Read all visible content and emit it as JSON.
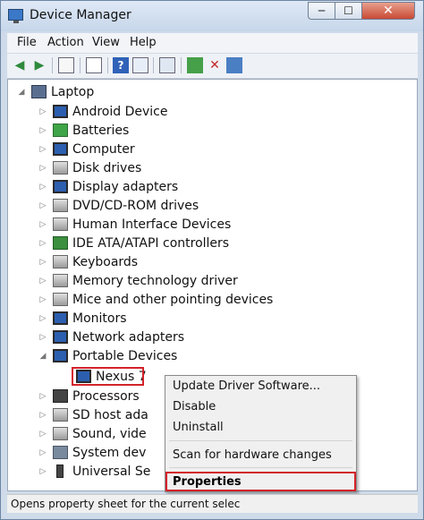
{
  "window": {
    "title": "Device Manager"
  },
  "menu": {
    "file": "File",
    "action": "Action",
    "view": "View",
    "help": "Help"
  },
  "toolbar": {
    "icons": [
      "back-icon",
      "forward-icon",
      "show-hide-icon",
      "properties-icon",
      "help-icon",
      "update-icon",
      "scan-icon",
      "update-driver-icon",
      "uninstall-icon",
      "enable-icon"
    ]
  },
  "tree": {
    "root": "Laptop",
    "items": [
      "Android Device",
      "Batteries",
      "Computer",
      "Disk drives",
      "Display adapters",
      "DVD/CD-ROM drives",
      "Human Interface Devices",
      "IDE ATA/ATAPI controllers",
      "Keyboards",
      "Memory technology driver",
      "Mice and other pointing devices",
      "Monitors",
      "Network adapters",
      "Portable Devices",
      "Nexus 7",
      "Processors",
      "SD host ada",
      "Sound, vide",
      "System dev",
      "Universal Se"
    ]
  },
  "context_menu": {
    "update_driver": "Update Driver Software...",
    "disable": "Disable",
    "uninstall": "Uninstall",
    "scan": "Scan for hardware changes",
    "properties": "Properties"
  },
  "status": {
    "text": "Opens property sheet for the current selec"
  }
}
